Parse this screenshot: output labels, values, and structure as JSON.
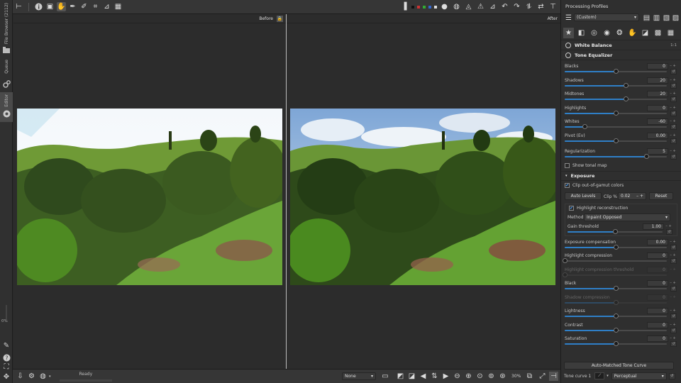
{
  "left_tabs": [
    {
      "label": "File Browser (2112)"
    },
    {
      "label": "Queue"
    },
    {
      "label": "Editor"
    }
  ],
  "left_zoom": "0%",
  "viewer": {
    "before_label": "Before",
    "after_label": "After"
  },
  "statusbar": {
    "ready": "Ready",
    "preview_profile": "None",
    "zoom": "30%"
  },
  "right_panel": {
    "processing_profiles_label": "Processing Profiles",
    "profile_value": "(Custom)",
    "white_balance": "White Balance",
    "white_balance_badge": "1:1",
    "tone_equalizer": "Tone Equalizer",
    "tone_sliders": [
      {
        "label": "Blacks",
        "value": "0",
        "frac": 0.5
      },
      {
        "label": "Shadows",
        "value": "20",
        "frac": 0.6
      },
      {
        "label": "Midtones",
        "value": "20",
        "frac": 0.6
      },
      {
        "label": "Highlights",
        "value": "0",
        "frac": 0.5
      },
      {
        "label": "Whites",
        "value": "-60",
        "frac": 0.2
      },
      {
        "label": "Pivot (Ev)",
        "value": "0.00",
        "frac": 0.5
      }
    ],
    "regularization": {
      "label": "Regularization",
      "value": "5",
      "frac": 0.8
    },
    "show_tonal_map": "Show tonal map",
    "exposure": "Exposure",
    "clip_out_of_gamut": "Clip out-of-gamut colors",
    "auto_levels": "Auto Levels",
    "clip_label": "Clip %",
    "clip_value": "0.02",
    "reset": "Reset",
    "highlight_reconstruction": "Highlight reconstruction",
    "method_label": "Method:",
    "method_value": "Inpaint Opposed",
    "gain_threshold": {
      "label": "Gain threshold",
      "value": "1.00",
      "frac": 0.5
    },
    "exposure_sliders": [
      {
        "label": "Exposure compensation",
        "value": "0.00",
        "frac": 0.5,
        "dim": false
      },
      {
        "label": "Highlight compression",
        "value": "0",
        "frac": 0.0,
        "dim": false
      },
      {
        "label": "Highlight compression threshold",
        "value": "0",
        "frac": 0.0,
        "dim": true
      },
      {
        "label": "Black",
        "value": "0",
        "frac": 0.5,
        "dim": false
      },
      {
        "label": "Shadow compression",
        "value": "0",
        "frac": 0.5,
        "dim": true
      },
      {
        "label": "Lightness",
        "value": "0",
        "frac": 0.5,
        "dim": false
      },
      {
        "label": "Contrast",
        "value": "0",
        "frac": 0.5,
        "dim": false
      },
      {
        "label": "Saturation",
        "value": "0",
        "frac": 0.5,
        "dim": false
      }
    ],
    "auto_matched_tone_curve": "Auto-Matched Tone Curve",
    "tone_curve_label": "Tone curve 1",
    "tone_curve_mode": "Perceptual"
  },
  "colors": {
    "accent": "#2f7fc7",
    "panel": "#2f2f2f",
    "toolbar": "#363636"
  }
}
